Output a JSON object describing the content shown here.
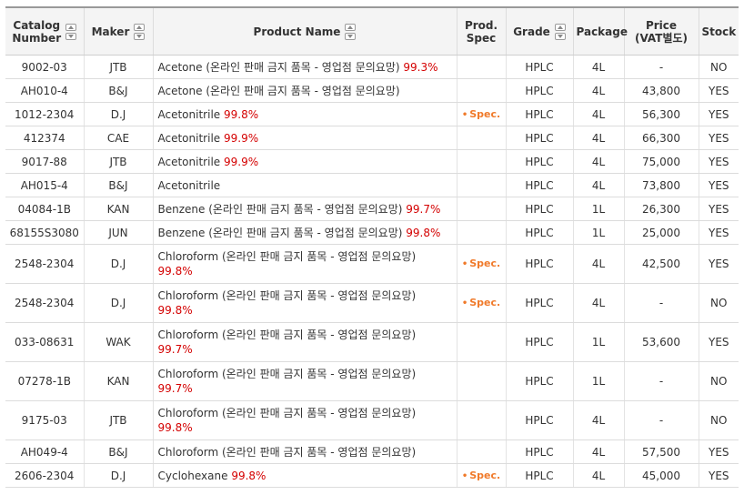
{
  "headers": {
    "catalog": "Catalog Number",
    "maker": "Maker",
    "product": "Product Name",
    "spec": "Prod. Spec",
    "grade": "Grade",
    "package": "Package",
    "price": "Price (VAT별도)",
    "stock": "Stock"
  },
  "header_lines": {
    "catalog_1": "Catalog",
    "catalog_2": "Number",
    "spec_1": "Prod.",
    "spec_2": "Spec",
    "price_1": "Price",
    "price_2": "(VAT별도)"
  },
  "spec_label": "Spec.",
  "rows": [
    {
      "catalog": "9002-03",
      "maker": "JTB",
      "name": "Acetone (온라인 판매 금지 품목 - 영업점 문의요망)",
      "purity": "99.3%",
      "spec": false,
      "grade": "HPLC",
      "package": "4L",
      "price": "-",
      "stock": "NO"
    },
    {
      "catalog": "AH010-4",
      "maker": "B&J",
      "name": "Acetone (온라인 판매 금지 품목 - 영업점 문의요망)",
      "purity": "",
      "spec": false,
      "grade": "HPLC",
      "package": "4L",
      "price": "43,800",
      "stock": "YES"
    },
    {
      "catalog": "1012-2304",
      "maker": "D.J",
      "name": "Acetonitrile",
      "purity": "99.8%",
      "spec": true,
      "grade": "HPLC",
      "package": "4L",
      "price": "56,300",
      "stock": "YES"
    },
    {
      "catalog": "412374",
      "maker": "CAE",
      "name": "Acetonitrile",
      "purity": "99.9%",
      "spec": false,
      "grade": "HPLC",
      "package": "4L",
      "price": "66,300",
      "stock": "YES"
    },
    {
      "catalog": "9017-88",
      "maker": "JTB",
      "name": "Acetonitrile",
      "purity": "99.9%",
      "spec": false,
      "grade": "HPLC",
      "package": "4L",
      "price": "75,000",
      "stock": "YES"
    },
    {
      "catalog": "AH015-4",
      "maker": "B&J",
      "name": "Acetonitrile",
      "purity": "",
      "spec": false,
      "grade": "HPLC",
      "package": "4L",
      "price": "73,800",
      "stock": "YES"
    },
    {
      "catalog": "04084-1B",
      "maker": "KAN",
      "name": "Benzene (온라인 판매 금지 품목 - 영업점 문의요망)",
      "purity": "99.7%",
      "spec": false,
      "grade": "HPLC",
      "package": "1L",
      "price": "26,300",
      "stock": "YES"
    },
    {
      "catalog": "68155S3080",
      "maker": "JUN",
      "name": "Benzene (온라인 판매 금지 품목 - 영업점 문의요망)",
      "purity": "99.8%",
      "spec": false,
      "grade": "HPLC",
      "package": "1L",
      "price": "25,000",
      "stock": "YES"
    },
    {
      "catalog": "2548-2304",
      "maker": "D.J",
      "name": "Chloroform (온라인 판매 금지 품목 - 영업점 문의요망)",
      "purity": "99.8%",
      "spec": true,
      "grade": "HPLC",
      "package": "4L",
      "price": "42,500",
      "stock": "YES",
      "tall": true
    },
    {
      "catalog": "2548-2304",
      "maker": "D.J",
      "name": "Chloroform (온라인 판매 금지 품목 - 영업점 문의요망)",
      "purity": "99.8%",
      "spec": true,
      "grade": "HPLC",
      "package": "4L",
      "price": "-",
      "stock": "NO",
      "tall": true
    },
    {
      "catalog": "033-08631",
      "maker": "WAK",
      "name": "Chloroform (온라인 판매 금지 품목 - 영업점 문의요망)",
      "purity": "99.7%",
      "spec": false,
      "grade": "HPLC",
      "package": "1L",
      "price": "53,600",
      "stock": "YES",
      "tall": true
    },
    {
      "catalog": "07278-1B",
      "maker": "KAN",
      "name": "Chloroform (온라인 판매 금지 품목 - 영업점 문의요망)",
      "purity": "99.7%",
      "spec": false,
      "grade": "HPLC",
      "package": "1L",
      "price": "-",
      "stock": "NO",
      "tall": true
    },
    {
      "catalog": "9175-03",
      "maker": "JTB",
      "name": "Chloroform (온라인 판매 금지 품목 - 영업점 문의요망)",
      "purity": "99.8%",
      "spec": false,
      "grade": "HPLC",
      "package": "4L",
      "price": "-",
      "stock": "NO",
      "tall": true
    },
    {
      "catalog": "AH049-4",
      "maker": "B&J",
      "name": "Chloroform (온라인 판매 금지 품목 - 영업점 문의요망)",
      "purity": "",
      "spec": false,
      "grade": "HPLC",
      "package": "4L",
      "price": "57,500",
      "stock": "YES"
    },
    {
      "catalog": "2606-2304",
      "maker": "D.J",
      "name": "Cyclohexane",
      "purity": "99.8%",
      "spec": true,
      "grade": "HPLC",
      "package": "4L",
      "price": "45,000",
      "stock": "YES"
    }
  ]
}
